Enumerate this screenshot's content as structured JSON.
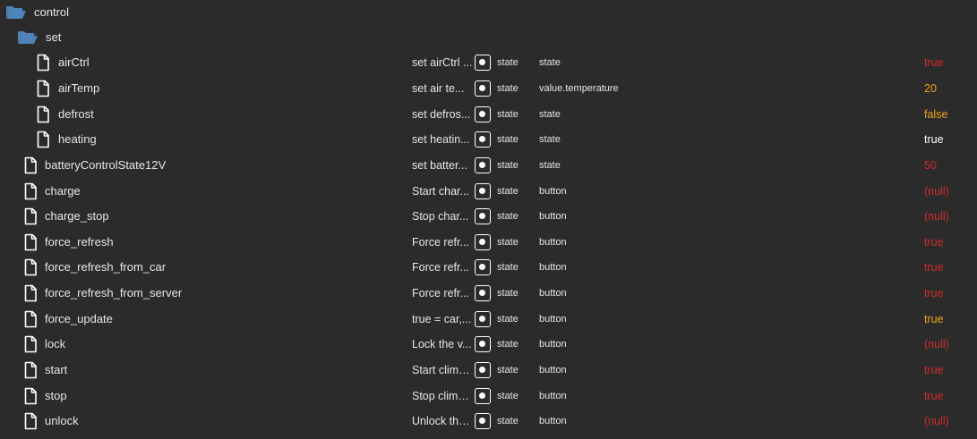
{
  "colors": {
    "background": "#2b2b2b",
    "folder_icon": "#4f83b8",
    "text": "#e6e6e6",
    "value_red": "#d12b2b",
    "value_orange": "#f0a21c",
    "value_white": "#ffffff"
  },
  "folders": [
    {
      "name": "control",
      "icon": "folder-open-icon"
    },
    {
      "name": "set",
      "icon": "folder-open-icon"
    }
  ],
  "states": [
    {
      "name": "airCtrl",
      "description": "set airCtrl ...",
      "type": "state",
      "role": "state",
      "value": "true",
      "value_color": "red"
    },
    {
      "name": "airTemp",
      "description": "set air te...",
      "type": "state",
      "role": "value.temperature",
      "value": "20",
      "value_color": "orange"
    },
    {
      "name": "defrost",
      "description": "set defros...",
      "type": "state",
      "role": "state",
      "value": "false",
      "value_color": "orange"
    },
    {
      "name": "heating",
      "description": "set heatin...",
      "type": "state",
      "role": "state",
      "value": "true",
      "value_color": "white"
    },
    {
      "name": "batteryControlState12V",
      "description": "set batter...",
      "type": "state",
      "role": "state",
      "value": "50",
      "value_color": "red"
    },
    {
      "name": "charge",
      "description": "Start char...",
      "type": "state",
      "role": "button",
      "value": "(null)",
      "value_color": "red"
    },
    {
      "name": "charge_stop",
      "description": "Stop char...",
      "type": "state",
      "role": "button",
      "value": "(null)",
      "value_color": "red"
    },
    {
      "name": "force_refresh",
      "description": "Force refr...",
      "type": "state",
      "role": "button",
      "value": "true",
      "value_color": "red"
    },
    {
      "name": "force_refresh_from_car",
      "description": "Force refr...",
      "type": "state",
      "role": "button",
      "value": "true",
      "value_color": "red"
    },
    {
      "name": "force_refresh_from_server",
      "description": "Force refr...",
      "type": "state",
      "role": "button",
      "value": "true",
      "value_color": "red"
    },
    {
      "name": "force_update",
      "description": "true = car,...",
      "type": "state",
      "role": "button",
      "value": "true",
      "value_color": "orange"
    },
    {
      "name": "lock",
      "description": "Lock the v...",
      "type": "state",
      "role": "button",
      "value": "(null)",
      "value_color": "red"
    },
    {
      "name": "start",
      "description": "Start clima...",
      "type": "state",
      "role": "button",
      "value": "true",
      "value_color": "red"
    },
    {
      "name": "stop",
      "description": "Stop clima...",
      "type": "state",
      "role": "button",
      "value": "true",
      "value_color": "red"
    },
    {
      "name": "unlock",
      "description": "Unlock the...",
      "type": "state",
      "role": "button",
      "value": "(null)",
      "value_color": "red"
    }
  ]
}
